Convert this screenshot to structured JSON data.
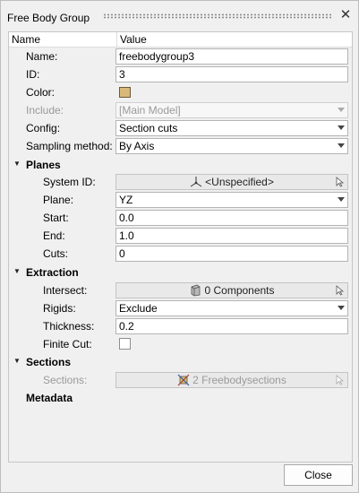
{
  "window": {
    "title": "Free Body Group"
  },
  "columns": {
    "name": "Name",
    "value": "Value"
  },
  "general": {
    "name_label": "Name:",
    "name_value": "freebodygroup3",
    "id_label": "ID:",
    "id_value": "3",
    "color_label": "Color:",
    "color_value": "#d9b97a",
    "include_label": "Include:",
    "include_value": "[Main Model]",
    "config_label": "Config:",
    "config_value": "Section cuts",
    "sampling_label": "Sampling method:",
    "sampling_value": "By Axis"
  },
  "planes": {
    "title": "Planes",
    "system_id_label": "System ID:",
    "system_id_value": "<Unspecified>",
    "plane_label": "Plane:",
    "plane_value": "YZ",
    "start_label": "Start:",
    "start_value": "0.0",
    "end_label": "End:",
    "end_value": "1.0",
    "cuts_label": "Cuts:",
    "cuts_value": "0"
  },
  "extraction": {
    "title": "Extraction",
    "intersect_label": "Intersect:",
    "intersect_value": "0 Components",
    "rigids_label": "Rigids:",
    "rigids_value": "Exclude",
    "thickness_label": "Thickness:",
    "thickness_value": "0.2",
    "finite_cut_label": "Finite Cut:",
    "finite_cut_checked": false
  },
  "sections": {
    "title": "Sections",
    "sections_label": "Sections:",
    "sections_value": "2 Freebodysections"
  },
  "metadata": {
    "title": "Metadata"
  },
  "footer": {
    "close_label": "Close"
  }
}
